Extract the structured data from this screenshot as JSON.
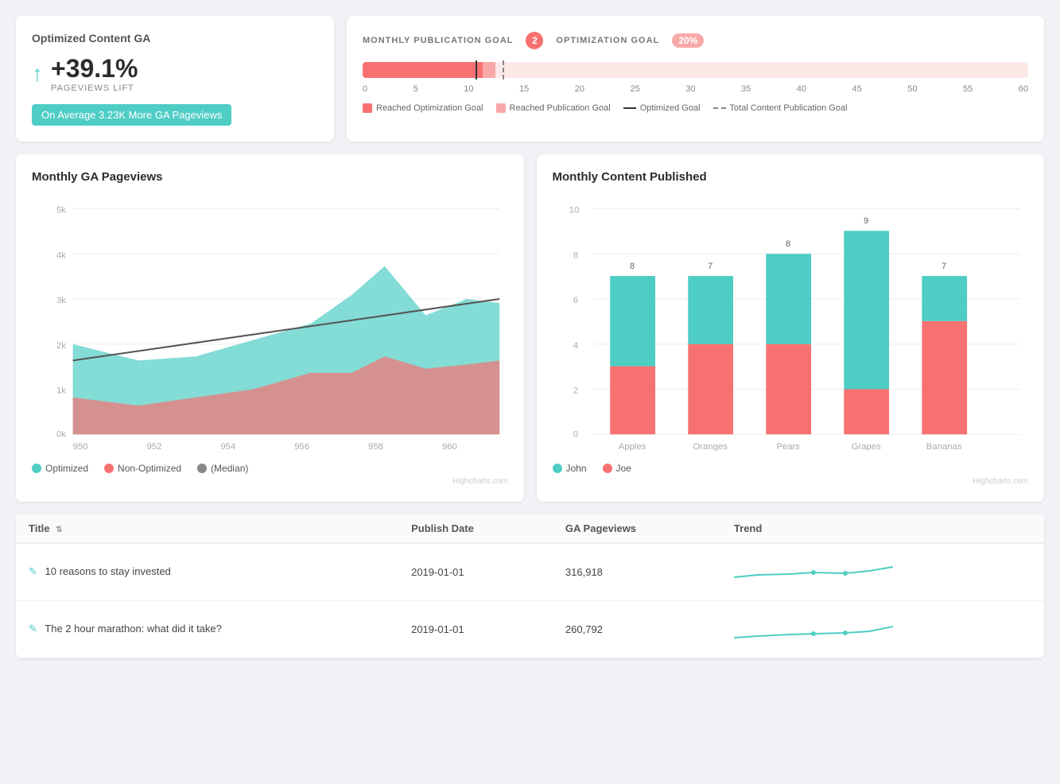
{
  "topLeft": {
    "title": "Optimized Content GA",
    "lift_pct": "+39.1%",
    "lift_label": "PAGEVIEWS LIFT",
    "avg_text": "On Average 3.23K More GA Pageviews"
  },
  "topRight": {
    "monthly_label": "MONTHLY PUBLICATION GOAL",
    "monthly_badge": "2",
    "optimization_label": "OPTIMIZATION GOAL",
    "optimization_badge": "20%",
    "axis": [
      "0",
      "5",
      "10",
      "15",
      "20",
      "25",
      "30",
      "35",
      "40",
      "45",
      "50",
      "55",
      "60"
    ],
    "legend": [
      {
        "label": "Reached Optimization Goal",
        "type": "dot",
        "color": "#f87171"
      },
      {
        "label": "Reached Publication Goal",
        "type": "dot",
        "color": "#f9a8a8"
      },
      {
        "label": "Optimized Goal",
        "type": "solid"
      },
      {
        "label": "Total Content Publication Goal",
        "type": "dashed"
      }
    ]
  },
  "chartLeft": {
    "title": "Monthly GA Pageviews",
    "legend": [
      {
        "label": "Optimized",
        "color": "#4ecdc4"
      },
      {
        "label": "Non-Optimized",
        "color": "#f87171"
      },
      {
        "label": "(Median)",
        "color": "#888"
      }
    ],
    "credit": "Highcharts.com",
    "yAxis": [
      "5k",
      "4k",
      "3k",
      "2k",
      "1k",
      "0k"
    ],
    "xAxis": [
      "950",
      "952",
      "954",
      "956",
      "958",
      "960",
      ""
    ]
  },
  "chartRight": {
    "title": "Monthly Content Published",
    "legend": [
      {
        "label": "John",
        "color": "#4ecdc4"
      },
      {
        "label": "Joe",
        "color": "#f87171"
      }
    ],
    "credit": "Highcharts.com",
    "categories": [
      "Apples",
      "Oranges",
      "Pears",
      "Grapes",
      "Bananas"
    ],
    "john": [
      5,
      3,
      4,
      7,
      2
    ],
    "joe": [
      3,
      4,
      4,
      2,
      5
    ],
    "totals": [
      8,
      7,
      8,
      9,
      7
    ],
    "yAxis": [
      "10",
      "8",
      "6",
      "4",
      "2",
      "0"
    ]
  },
  "table": {
    "columns": [
      {
        "label": "Title",
        "sortable": true
      },
      {
        "label": "Publish Date",
        "sortable": false
      },
      {
        "label": "GA Pageviews",
        "sortable": false
      },
      {
        "label": "Trend",
        "sortable": false
      }
    ],
    "rows": [
      {
        "title": "10 reasons to stay invested",
        "date": "2019-01-01",
        "pageviews": "316,918"
      },
      {
        "title": "The 2 hour marathon: what did it take?",
        "date": "2019-01-01",
        "pageviews": "260,792"
      }
    ]
  }
}
